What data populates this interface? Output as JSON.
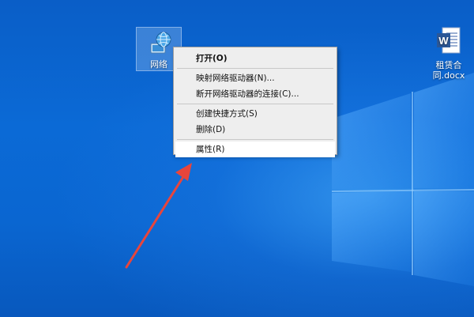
{
  "desktop": {
    "icons": [
      {
        "label": "网络",
        "icon": "network-icon"
      },
      {
        "label": "租赁合同.docx",
        "icon": "word-document-icon"
      }
    ]
  },
  "context_menu": {
    "items": [
      {
        "label": "打开(O)",
        "bold": true
      },
      {
        "label": "映射网络驱动器(N)..."
      },
      {
        "label": "断开网络驱动器的连接(C)..."
      },
      {
        "label": "创建快捷方式(S)"
      },
      {
        "label": "删除(D)"
      },
      {
        "label": "属性(R)",
        "highlighted": true
      }
    ]
  },
  "colors": {
    "desktop_background": "#0a5ec7",
    "menu_background": "#eeeeee",
    "annotation_arrow": "#e8453c"
  }
}
